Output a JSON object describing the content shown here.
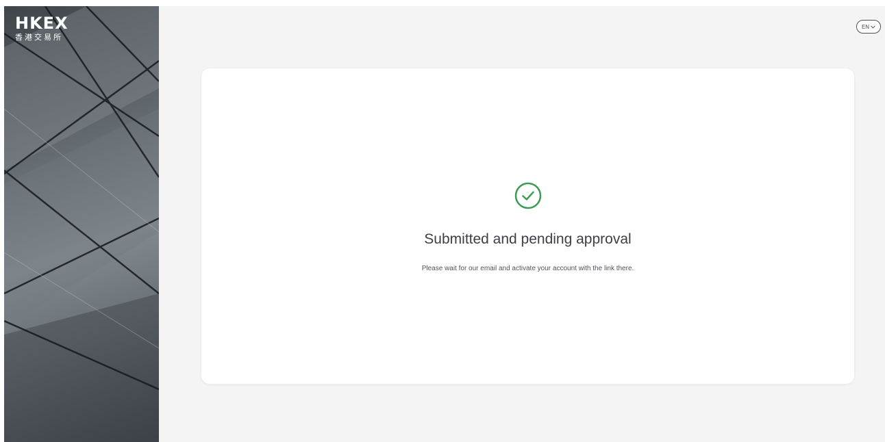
{
  "brand": {
    "logo_text": "HKEX",
    "logo_subtitle": "香港交易所"
  },
  "header": {
    "language": {
      "label": "EN",
      "icon": "chevron-down-icon"
    }
  },
  "card": {
    "status_icon": "check-circle-icon",
    "title": "Submitted and pending approval",
    "description": "Please wait for our email and activate your account with the link there."
  },
  "colors": {
    "success": "#3a9b52",
    "sidebar_dark": "#3f454b",
    "background": "#f4f4f5",
    "card": "#ffffff",
    "text": "#3c4046"
  }
}
